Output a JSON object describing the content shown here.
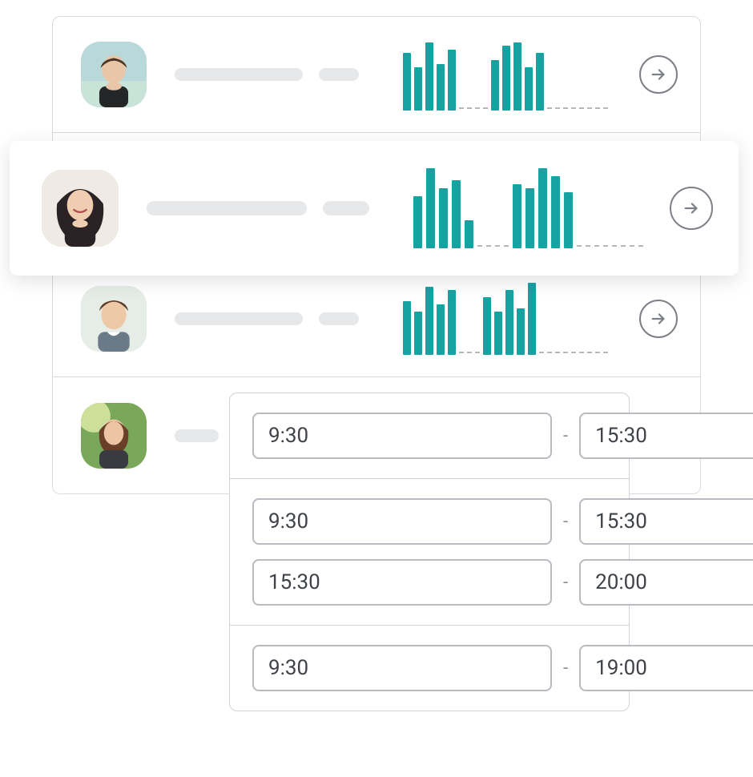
{
  "colors": {
    "accent": "#17a2a2",
    "border": "#cfd3d6",
    "placeholder": "#e6e8ea",
    "icon": "#7d8086"
  },
  "rows": [
    {
      "id": "user-1",
      "name_placeholder": "",
      "detail_placeholder": ""
    },
    {
      "id": "user-2",
      "name_placeholder": "",
      "detail_placeholder": ""
    },
    {
      "id": "user-3",
      "name_placeholder": "",
      "detail_placeholder": ""
    },
    {
      "id": "user-4",
      "name_placeholder": "",
      "detail_placeholder": ""
    }
  ],
  "chart_data": [
    {
      "type": "bar",
      "title": "",
      "xlabel": "",
      "ylabel": "",
      "ylim": [
        0,
        100
      ],
      "values": [
        80,
        60,
        95,
        65,
        85,
        0,
        0,
        0,
        0,
        70,
        90,
        95,
        60,
        80,
        0,
        0,
        0,
        0,
        0,
        0,
        0,
        0
      ]
    },
    {
      "type": "bar",
      "title": "",
      "xlabel": "",
      "ylabel": "",
      "ylim": [
        0,
        100
      ],
      "values": [
        65,
        100,
        75,
        85,
        35,
        0,
        0,
        0,
        0,
        80,
        75,
        100,
        90,
        70,
        0,
        0,
        0,
        0,
        0,
        0,
        0,
        0
      ]
    },
    {
      "type": "bar",
      "title": "",
      "xlabel": "",
      "ylabel": "",
      "ylim": [
        0,
        100
      ],
      "values": [
        75,
        60,
        95,
        70,
        90,
        0,
        0,
        0,
        80,
        60,
        90,
        65,
        100,
        0,
        0,
        0,
        0,
        0,
        0,
        0,
        0,
        0
      ]
    }
  ],
  "time_editor": {
    "separator": "-",
    "sections": [
      {
        "ranges": [
          {
            "start": "9:30",
            "end": "15:30"
          }
        ]
      },
      {
        "ranges": [
          {
            "start": "9:30",
            "end": "15:30"
          },
          {
            "start": "15:30",
            "end": "20:00"
          }
        ]
      },
      {
        "ranges": [
          {
            "start": "9:30",
            "end": "19:00"
          }
        ]
      }
    ]
  }
}
